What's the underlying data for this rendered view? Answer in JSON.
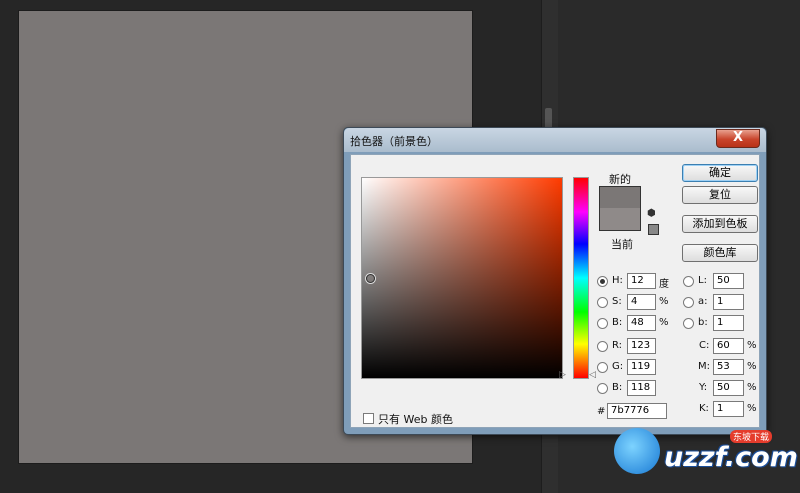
{
  "dialog": {
    "title": "拾色器（前景色）",
    "close_label": "X",
    "new_label": "新的",
    "current_label": "当前",
    "swatch_new_color": "#7b7776",
    "swatch_current_color": "#8f8a89",
    "buttons": {
      "ok": "确定",
      "reset": "复位",
      "add_swatch": "添加到色板",
      "libraries": "颜色库"
    },
    "hsb": {
      "h_label": "H:",
      "h_value": "12",
      "h_unit": "度",
      "s_label": "S:",
      "s_value": "4",
      "s_unit": "%",
      "b_label": "B:",
      "b_value": "48",
      "b_unit": "%"
    },
    "rgb": {
      "r_label": "R:",
      "r_value": "123",
      "g_label": "G:",
      "g_value": "119",
      "b_label": "B:",
      "b_value": "118"
    },
    "hex": {
      "label": "#",
      "value": "7b7776"
    },
    "lab": {
      "l_label": "L:",
      "l_value": "50",
      "a_label": "a:",
      "a_value": "1",
      "b_label": "b:",
      "b_value": "1"
    },
    "cmyk": {
      "c_label": "C:",
      "c_value": "60",
      "m_label": "M:",
      "m_value": "53",
      "y_label": "Y:",
      "y_value": "50",
      "k_label": "K:",
      "k_value": "1",
      "unit": "%"
    },
    "web_only_label": "只有 Web 颜色"
  },
  "canvas_color": "#7b7776",
  "watermark": {
    "text": "uzzf.com",
    "tag": "东坡下载"
  }
}
